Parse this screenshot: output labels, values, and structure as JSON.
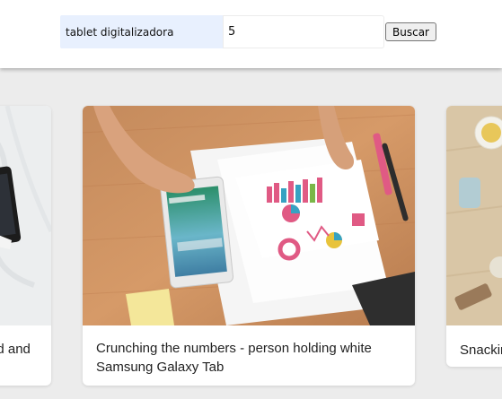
{
  "search": {
    "query_value": "tablet digitalizadora",
    "count_value": "5",
    "button_label": "Buscar"
  },
  "results": [
    {
      "caption": "ad and"
    },
    {
      "caption": "Crunching the numbers - person holding white Samsung Galaxy Tab"
    },
    {
      "caption": "Snackin"
    }
  ]
}
